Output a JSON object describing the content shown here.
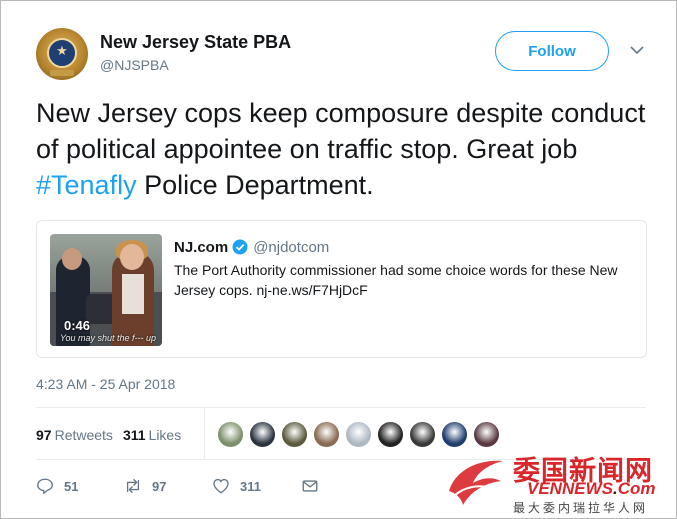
{
  "user": {
    "name": "New Jersey State PBA",
    "handle": "@NJSPBA"
  },
  "follow_label": "Follow",
  "tweet": {
    "text_before": "New Jersey cops keep composure despite conduct of political appointee on traffic stop. Great job ",
    "hashtag": "#Tenafly",
    "text_after": " Police Department."
  },
  "card": {
    "source_name": "NJ.com",
    "source_handle": "@njdotcom",
    "text": "The Port Authority commissioner had some choice words for these New Jersey cops. nj-ne.ws/F7HjDcF",
    "video_duration": "0:46",
    "video_caption": "You may shut the f--- up"
  },
  "timestamp": "4:23 AM - 25 Apr 2018",
  "stats": {
    "retweets_count": "97",
    "retweets_label": "Retweets",
    "likes_count": "311",
    "likes_label": "Likes"
  },
  "likers_colors": [
    "#7d8f6a",
    "#2b3440",
    "#5b5a3e",
    "#8a6a52",
    "#aeb8c2",
    "#222222",
    "#3a3a3a",
    "#1f3d6e",
    "#5a3a40"
  ],
  "actions": {
    "reply_count": "51",
    "retweet_count": "97",
    "like_count": "311"
  },
  "watermark": {
    "chinese": "委国新闻网",
    "english_left": "VENNEWS",
    "english_dot": ".",
    "english_right": "Com",
    "subtitle": "最大委内瑞拉华人网"
  },
  "colors": {
    "accent": "#1da1f2",
    "text": "#14171a",
    "muted": "#657786",
    "watermark_red": "#d8262b"
  }
}
